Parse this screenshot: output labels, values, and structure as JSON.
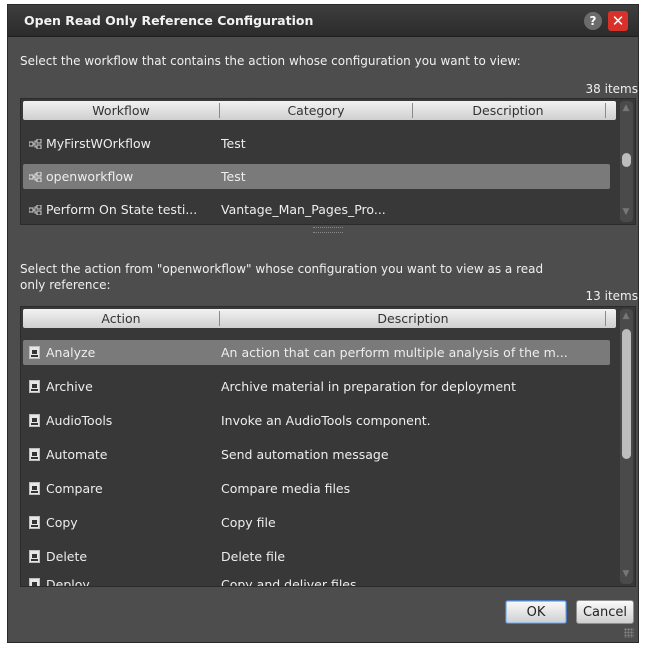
{
  "dialog": {
    "title": "Open Read Only Reference Configuration",
    "help_label": "?",
    "close_label": "✕"
  },
  "workflow_section": {
    "prompt": "Select the workflow that contains the action whose configuration you want to view:",
    "count": "38 items",
    "columns": [
      "Workflow",
      "Category",
      "Description"
    ],
    "rows": [
      {
        "name": "MyFirstWOrkflow",
        "category": "Test",
        "description": ""
      },
      {
        "name": "openworkflow",
        "category": "Test",
        "description": ""
      },
      {
        "name": "Perform On State testi...",
        "category": "Vantage_Man_Pages_Pro...",
        "description": ""
      }
    ],
    "selected_index": 1
  },
  "action_section": {
    "prompt": "Select the action from \"openworkflow\" whose configuration you want to view as a read only reference:",
    "count": "13 items",
    "columns": [
      "Action",
      "Description"
    ],
    "rows": [
      {
        "name": "Analyze",
        "description": "An action that can perform multiple analysis of the m..."
      },
      {
        "name": "Archive",
        "description": "Archive material in preparation for deployment"
      },
      {
        "name": "AudioTools",
        "description": "Invoke an AudioTools component."
      },
      {
        "name": "Automate",
        "description": "Send automation message"
      },
      {
        "name": "Compare",
        "description": "Compare media files"
      },
      {
        "name": "Copy",
        "description": "Copy file"
      },
      {
        "name": "Delete",
        "description": "Delete file"
      },
      {
        "name": "Deploy",
        "description": "Copy and deliver files"
      }
    ],
    "selected_index": 0
  },
  "buttons": {
    "ok": "OK",
    "cancel": "Cancel"
  }
}
